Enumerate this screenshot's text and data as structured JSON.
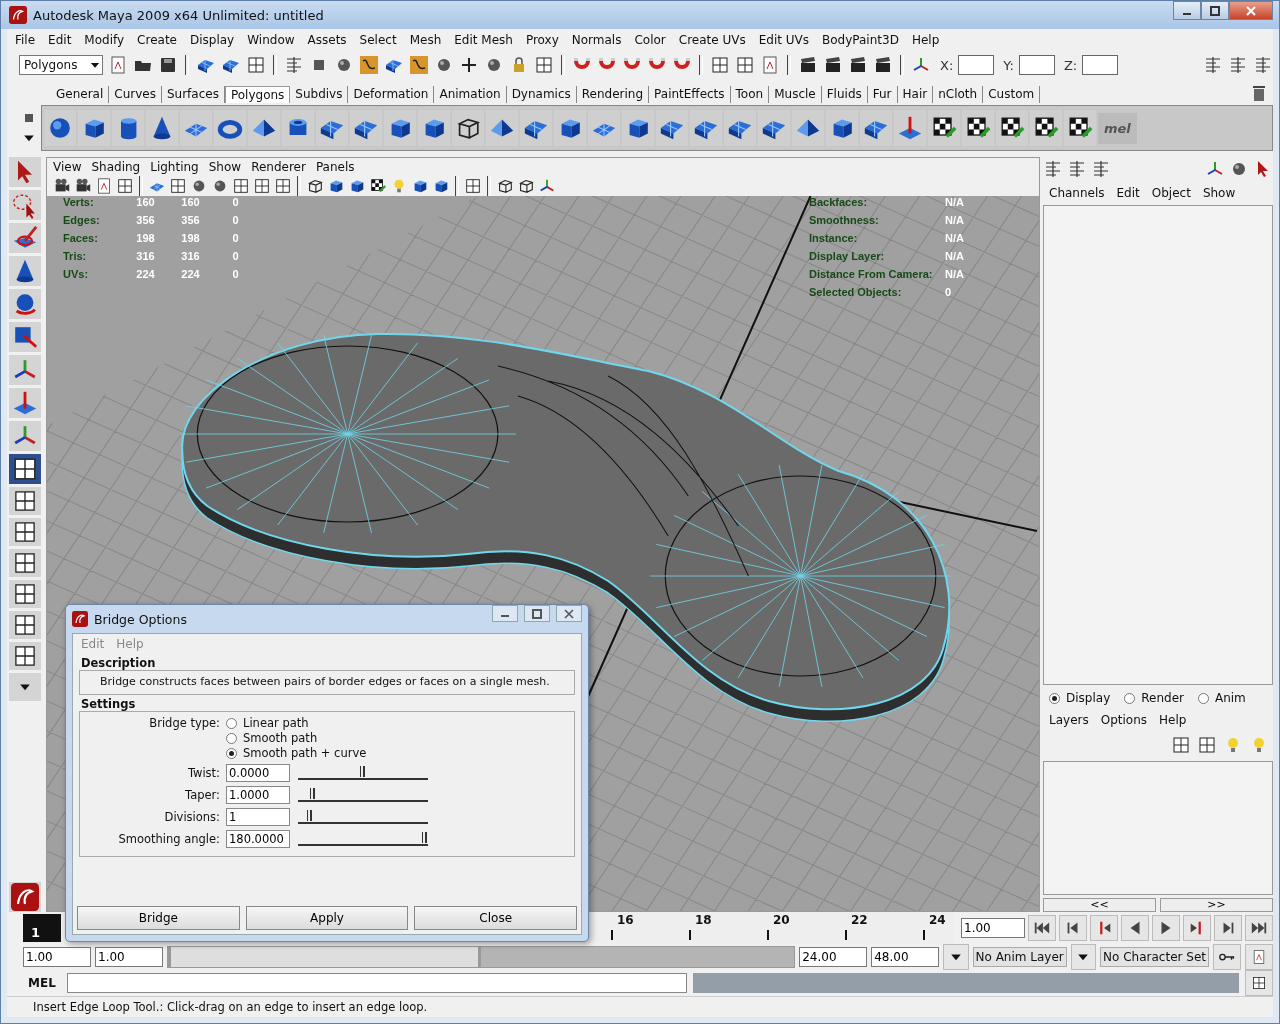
{
  "window": {
    "title": "Autodesk Maya 2009 x64 Unlimited: untitled"
  },
  "menu_bar": [
    "File",
    "Edit",
    "Modify",
    "Create",
    "Display",
    "Window",
    "Assets",
    "Select",
    "Mesh",
    "Edit Mesh",
    "Proxy",
    "Normals",
    "Color",
    "Create UVs",
    "Edit UVs",
    "BodyPaint3D",
    "Help"
  ],
  "status_line": {
    "mode_menu": "Polygons",
    "x_label": "X:",
    "y_label": "Y:",
    "z_label": "Z:"
  },
  "shelf_tabs": [
    {
      "label": "General",
      "selected": false
    },
    {
      "label": "Curves",
      "selected": false
    },
    {
      "label": "Surfaces",
      "selected": false
    },
    {
      "label": "Polygons",
      "selected": true
    },
    {
      "label": "Subdivs",
      "selected": false
    },
    {
      "label": "Deformation",
      "selected": false
    },
    {
      "label": "Animation",
      "selected": false
    },
    {
      "label": "Dynamics",
      "selected": false
    },
    {
      "label": "Rendering",
      "selected": false
    },
    {
      "label": "PaintEffects",
      "selected": false
    },
    {
      "label": "Toon",
      "selected": false
    },
    {
      "label": "Muscle",
      "selected": false
    },
    {
      "label": "Fluids",
      "selected": false
    },
    {
      "label": "Fur",
      "selected": false
    },
    {
      "label": "Hair",
      "selected": false
    },
    {
      "label": "nCloth",
      "selected": false
    },
    {
      "label": "Custom",
      "selected": false
    }
  ],
  "shelf": {
    "mel_label": "mel"
  },
  "viewport": {
    "menu": [
      "View",
      "Shading",
      "Lighting",
      "Show",
      "Renderer",
      "Panels"
    ],
    "hud_left": [
      {
        "label": "Verts:",
        "values": [
          "160",
          "160",
          "0"
        ]
      },
      {
        "label": "Edges:",
        "values": [
          "356",
          "356",
          "0"
        ]
      },
      {
        "label": "Faces:",
        "values": [
          "198",
          "198",
          "0"
        ]
      },
      {
        "label": "Tris:",
        "values": [
          "316",
          "316",
          "0"
        ]
      },
      {
        "label": "UVs:",
        "values": [
          "224",
          "224",
          "0"
        ]
      }
    ],
    "hud_right": [
      {
        "label": "Backfaces:",
        "value": "N/A"
      },
      {
        "label": "Smoothness:",
        "value": "N/A"
      },
      {
        "label": "Instance:",
        "value": "N/A"
      },
      {
        "label": "Display Layer:",
        "value": "N/A"
      },
      {
        "label": "Distance From Camera:",
        "value": "N/A"
      },
      {
        "label": "Selected Objects:",
        "value": "0"
      }
    ]
  },
  "channel_box": {
    "menu": [
      "Channels",
      "Edit",
      "Object",
      "Show"
    ]
  },
  "layer_editor": {
    "modes": [
      {
        "label": "Display",
        "selected": true
      },
      {
        "label": "Render",
        "selected": false
      },
      {
        "label": "Anim",
        "selected": false
      }
    ],
    "menu": [
      "Layers",
      "Options",
      "Help"
    ],
    "prev": "<<",
    "next": ">>"
  },
  "time_slider": {
    "level": 0,
    "current_frame": "1",
    "ticks": [
      "16",
      "18",
      "20",
      "22",
      "24"
    ],
    "current_time": "1.00"
  },
  "range_slider": {
    "level": 0.5,
    "start": "1.00",
    "inner_start": "1.00",
    "inner_end": "24.00",
    "end": "48.00",
    "anim_layer": "No Anim Layer",
    "character_set": "No Character Set"
  },
  "command_line": {
    "label": "MEL"
  },
  "help_line": "Insert Edge Loop Tool.: Click-drag on an edge to insert an edge loop.",
  "dialog": {
    "title": "Bridge Options",
    "menu": [
      "Edit",
      "Help"
    ],
    "description_title": "Description",
    "description": "Bridge constructs faces between pairs of border edges or faces on a single mesh.",
    "settings_title": "Settings",
    "bridge_type_label": "Bridge type:",
    "bridge_types": [
      {
        "label": "Linear path",
        "selected": false
      },
      {
        "label": "Smooth path",
        "selected": false
      },
      {
        "label": "Smooth path + curve",
        "selected": true
      }
    ],
    "fields": [
      {
        "label": "Twist:",
        "value": "0.0000",
        "level": 0.5
      },
      {
        "label": "Taper:",
        "value": "1.0000",
        "level": 0.1
      },
      {
        "label": "Divisions:",
        "value": "1",
        "level": 0.07
      },
      {
        "label": "Smoothing angle:",
        "value": "180.0000",
        "level": 1
      }
    ],
    "buttons": [
      "Bridge",
      "Apply",
      "Close"
    ]
  }
}
